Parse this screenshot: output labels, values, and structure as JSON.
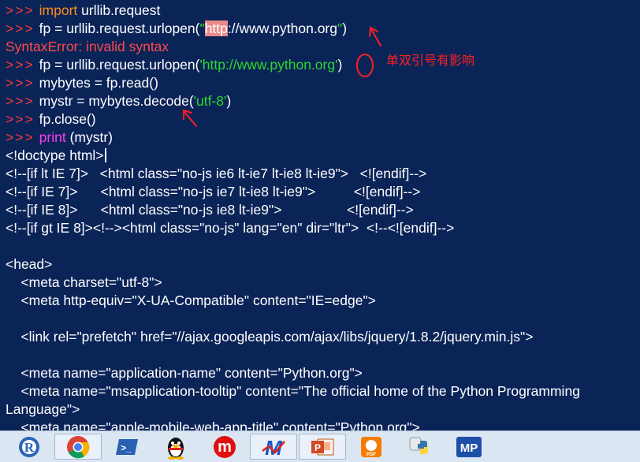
{
  "console": {
    "line1": {
      "prompt": ">>>",
      "kw": "import",
      "rest": " urllib.request"
    },
    "line2": {
      "prompt": ">>>",
      "pre": "fp = urllib.request.urlopen(",
      "q1": "\"",
      "hl": "http",
      "str": "://www.python.org",
      "q2": "\"",
      "close": ")"
    },
    "line3": {
      "error": "SyntaxError: invalid syntax"
    },
    "line4": {
      "prompt": ">>>",
      "pre": "fp = urllib.request.urlopen(",
      "str": "'http://www.python.org'",
      "close": ")"
    },
    "line5": {
      "prompt": ">>>",
      "text": "mybytes = fp.read()"
    },
    "line6": {
      "prompt": ">>>",
      "pre": "mystr = mybytes.decode(",
      "str": "'utf-8'",
      "close": ")"
    },
    "line7": {
      "prompt": ">>>",
      "text": "fp.close()"
    },
    "line8": {
      "prompt": ">>>",
      "kw": "print",
      "rest": " (mystr)"
    },
    "output": [
      "<!doctype html>",
      "<!--[if lt IE 7]>   <html class=\"no-js ie6 lt-ie7 lt-ie8 lt-ie9\">   <![endif]-->",
      "<!--[if IE 7]>      <html class=\"no-js ie7 lt-ie8 lt-ie9\">          <![endif]-->",
      "<!--[if IE 8]>      <html class=\"no-js ie8 lt-ie9\">                 <![endif]-->",
      "<!--[if gt IE 8]><!--><html class=\"no-js\" lang=\"en\" dir=\"ltr\">  <!--<![endif]-->",
      "",
      "<head>",
      "    <meta charset=\"utf-8\">",
      "    <meta http-equiv=\"X-UA-Compatible\" content=\"IE=edge\">",
      "",
      "    <link rel=\"prefetch\" href=\"//ajax.googleapis.com/ajax/libs/jquery/1.8.2/jquery.min.js\">",
      "",
      "    <meta name=\"application-name\" content=\"Python.org\">",
      "    <meta name=\"msapplication-tooltip\" content=\"The official home of the Python Programming",
      "Language\">",
      "    <meta name=\"apple-mobile-web-app-title\" content=\"Python.org\">"
    ]
  },
  "annotation": {
    "note": "单双引号有影响"
  },
  "taskbar": {
    "items": [
      {
        "name": "r-app",
        "glyph": "R"
      },
      {
        "name": "chrome",
        "glyph": ""
      },
      {
        "name": "powershell",
        "glyph": ">_"
      },
      {
        "name": "qq",
        "glyph": ""
      },
      {
        "name": "m-app",
        "glyph": "m"
      },
      {
        "name": "m-logo-app",
        "glyph": "M"
      },
      {
        "name": "powerpoint",
        "glyph": "P"
      },
      {
        "name": "pdf-app",
        "glyph": "PDF"
      },
      {
        "name": "python",
        "glyph": ""
      },
      {
        "name": "mp-app",
        "glyph": "MP"
      }
    ]
  },
  "colors": {
    "background": "#0b2458",
    "prompt": "#ff3a3a",
    "keyword": "#ff8a1c",
    "builtin": "#ff3cf0",
    "string": "#2bd92b",
    "annotation": "#ff2020"
  }
}
